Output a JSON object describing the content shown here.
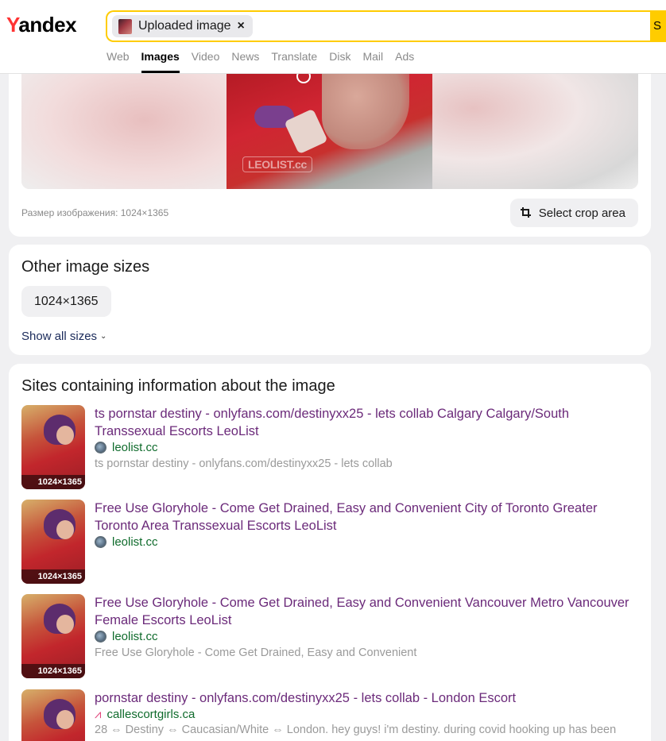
{
  "header": {
    "logo_initial": "Y",
    "logo_rest": "andex",
    "search": {
      "chip_label": "Uploaded image",
      "chip_close": "×",
      "button_label": "S"
    },
    "tabs": [
      {
        "label": "Web",
        "active": false
      },
      {
        "label": "Images",
        "active": true
      },
      {
        "label": "Video",
        "active": false
      },
      {
        "label": "News",
        "active": false
      },
      {
        "label": "Translate",
        "active": false
      },
      {
        "label": "Disk",
        "active": false
      },
      {
        "label": "Mail",
        "active": false
      },
      {
        "label": "Ads",
        "active": false
      }
    ]
  },
  "preview": {
    "watermark": "LEOLIST.cc",
    "size_note": "Размер изображения: 1024×1365",
    "crop_button_label": "Select crop area"
  },
  "other_sizes": {
    "title": "Other image sizes",
    "sizes": [
      "1024×1365"
    ],
    "show_all_label": "Show all sizes",
    "show_all_chevron": "⌄"
  },
  "sites": {
    "title": "Sites containing information about the image",
    "results": [
      {
        "title": "ts pornstar destiny - onlyfans.com/destinyxx25 - lets collab Calgary Calgary/South Transsexual Escorts LeoList",
        "site": "leolist.cc",
        "site_icon": "globe-icon",
        "snippet": "ts pornstar destiny - onlyfans.com/destinyxx25 - lets collab",
        "thumb_size": "1024×1365"
      },
      {
        "title": "Free Use Gloryhole - Come Get Drained, Easy and Convenient City of Toronto Greater Toronto Area Transsexual Escorts LeoList",
        "site": "leolist.cc",
        "site_icon": "globe-icon",
        "snippet": "",
        "thumb_size": "1024×1365"
      },
      {
        "title": "Free Use Gloryhole - Come Get Drained, Easy and Convenient Vancouver Metro Vancouver Female Escorts LeoList",
        "site": "leolist.cc",
        "site_icon": "globe-icon",
        "snippet": "Free Use Gloryhole - Come Get Drained, Easy and Convenient",
        "thumb_size": "1024×1365"
      },
      {
        "title": "pornstar destiny - onlyfans.com/destinyxx25 - lets collab - London Escort",
        "site": "callescortgirls.ca",
        "site_icon": "heels-icon",
        "snippet": "28 ⇔ Destiny ⇔ Caucasian/White ⇔ London. hey guys! i'm destiny. during covid hooking up has been",
        "thumb_size": ""
      }
    ]
  }
}
